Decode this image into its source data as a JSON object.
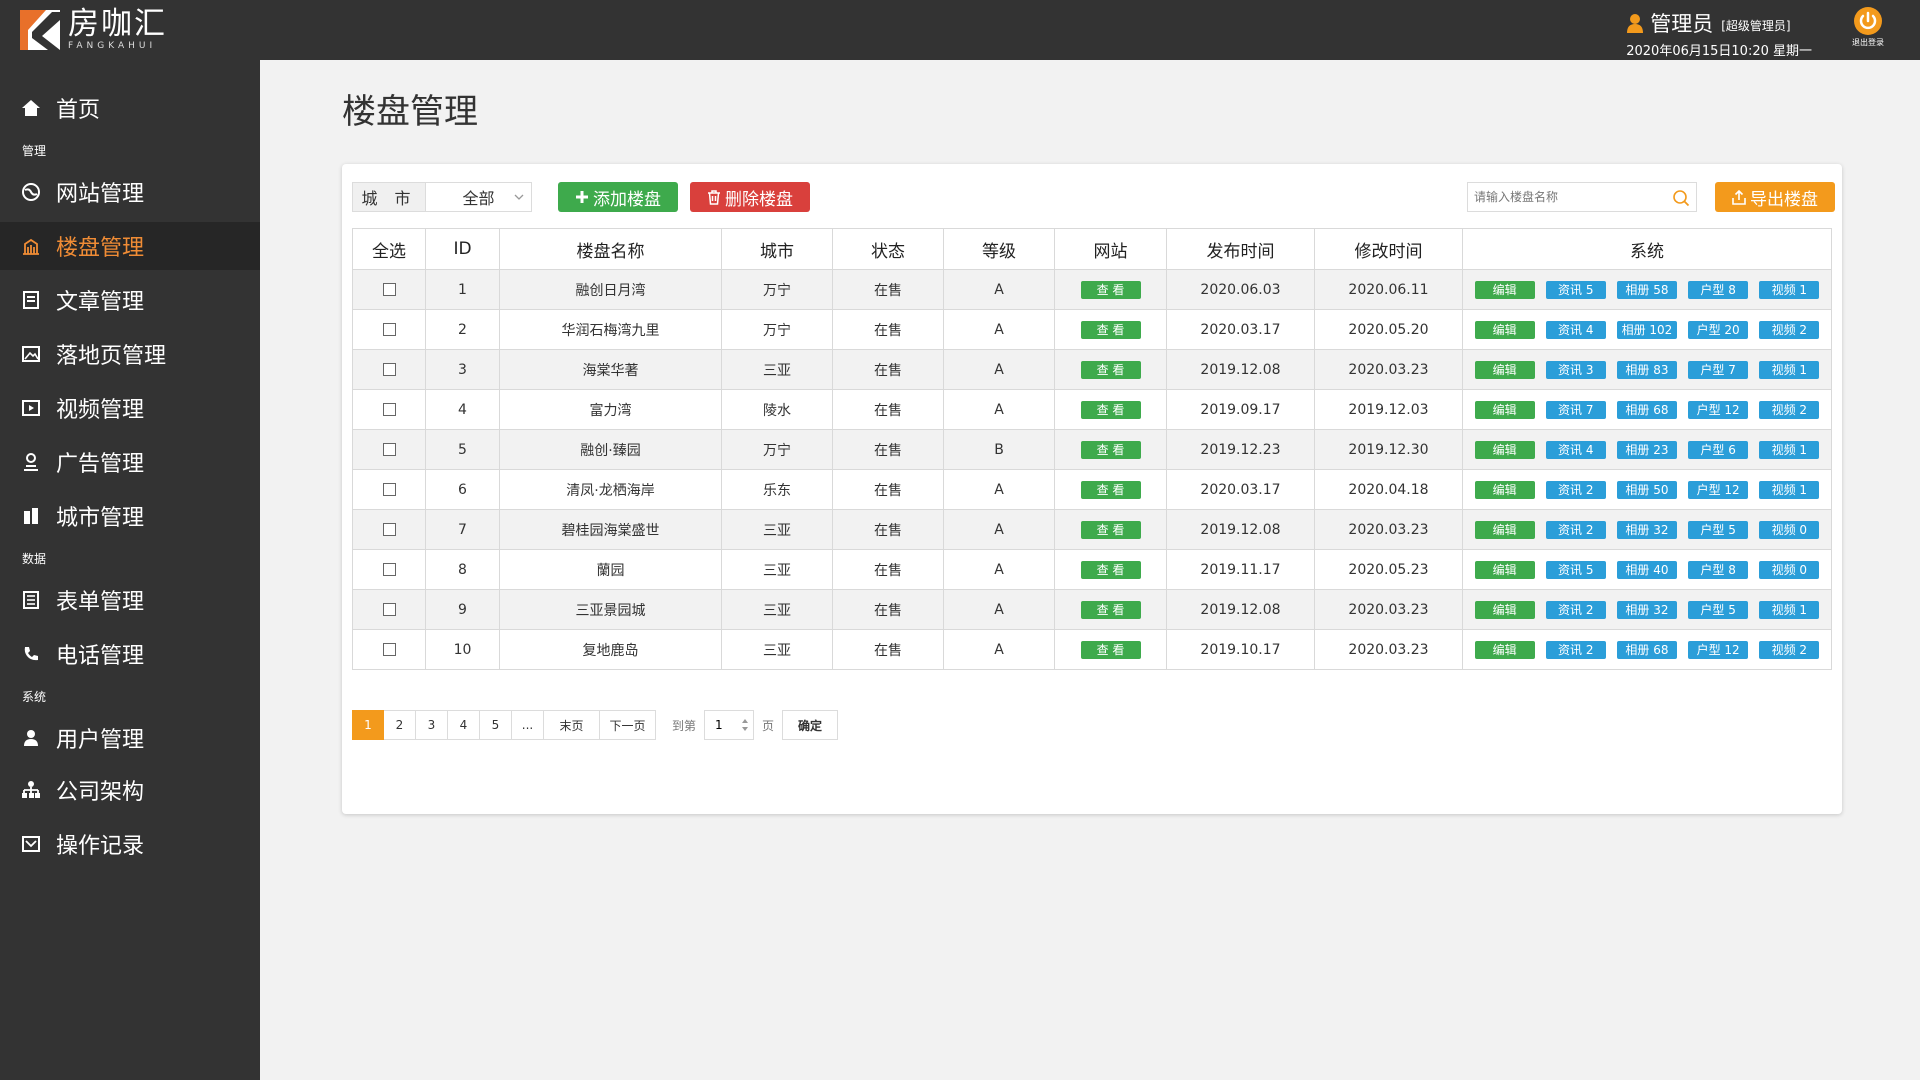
{
  "brand": {
    "name_cn": "房咖汇",
    "name_en": "FANGKAHUI"
  },
  "header": {
    "user_name": "管理员",
    "user_role": "[超级管理员]",
    "datetime": "2020年06月15日10:20 星期一",
    "logout_label": "退出登录"
  },
  "sidebar": {
    "home": "首页",
    "section_manage": "管理",
    "section_data": "数据",
    "section_system": "系统",
    "items": [
      {
        "label": "网站管理",
        "icon": "globe-icon"
      },
      {
        "label": "楼盘管理",
        "icon": "building-icon",
        "active": true
      },
      {
        "label": "文章管理",
        "icon": "article-icon"
      },
      {
        "label": "落地页管理",
        "icon": "image-icon"
      },
      {
        "label": "视频管理",
        "icon": "video-icon"
      },
      {
        "label": "广告管理",
        "icon": "ad-icon"
      },
      {
        "label": "城市管理",
        "icon": "city-icon"
      },
      {
        "label": "表单管理",
        "icon": "form-icon"
      },
      {
        "label": "电话管理",
        "icon": "phone-icon"
      },
      {
        "label": "用户管理",
        "icon": "user-icon"
      },
      {
        "label": "公司架构",
        "icon": "org-chart-icon"
      },
      {
        "label": "操作记录",
        "icon": "log-icon"
      }
    ]
  },
  "page": {
    "title": "楼盘管理"
  },
  "toolbar": {
    "city_label": "城 市",
    "city_value": "全部",
    "add_label": "添加楼盘",
    "delete_label": "删除楼盘",
    "search_placeholder": "请输入楼盘名称",
    "export_label": "导出楼盘"
  },
  "table": {
    "headers": [
      "全选",
      "ID",
      "楼盘名称",
      "城市",
      "状态",
      "等级",
      "网站",
      "发布时间",
      "修改时间",
      "系统"
    ],
    "view_label": "查 看",
    "edit_label": "编辑",
    "rows": [
      {
        "id": "1",
        "name": "融创日月湾",
        "city": "万宁",
        "status": "在售",
        "level": "A",
        "published": "2020.06.03",
        "modified": "2020.06.11",
        "news": "资讯 5",
        "album": "相册 58",
        "layout": "户型 8",
        "video": "视频 1"
      },
      {
        "id": "2",
        "name": "华润石梅湾九里",
        "city": "万宁",
        "status": "在售",
        "level": "A",
        "published": "2020.03.17",
        "modified": "2020.05.20",
        "news": "资讯 4",
        "album": "相册 102",
        "layout": "户型 20",
        "video": "视频 2"
      },
      {
        "id": "3",
        "name": "海棠华著",
        "city": "三亚",
        "status": "在售",
        "level": "A",
        "published": "2019.12.08",
        "modified": "2020.03.23",
        "news": "资讯 3",
        "album": "相册 83",
        "layout": "户型 7",
        "video": "视频 1"
      },
      {
        "id": "4",
        "name": "富力湾",
        "city": "陵水",
        "status": "在售",
        "level": "A",
        "published": "2019.09.17",
        "modified": "2019.12.03",
        "news": "资讯 7",
        "album": "相册 68",
        "layout": "户型 12",
        "video": "视频 2"
      },
      {
        "id": "5",
        "name": "融创·臻园",
        "city": "万宁",
        "status": "在售",
        "level": "B",
        "published": "2019.12.23",
        "modified": "2019.12.30",
        "news": "资讯 4",
        "album": "相册 23",
        "layout": "户型 6",
        "video": "视频 1"
      },
      {
        "id": "6",
        "name": "清凤·龙栖海岸",
        "city": "乐东",
        "status": "在售",
        "level": "A",
        "published": "2020.03.17",
        "modified": "2020.04.18",
        "news": "资讯 2",
        "album": "相册 50",
        "layout": "户型 12",
        "video": "视频 1"
      },
      {
        "id": "7",
        "name": "碧桂园海棠盛世",
        "city": "三亚",
        "status": "在售",
        "level": "A",
        "published": "2019.12.08",
        "modified": "2020.03.23",
        "news": "资讯 2",
        "album": "相册 32",
        "layout": "户型 5",
        "video": "视频 0"
      },
      {
        "id": "8",
        "name": "蘭园",
        "city": "三亚",
        "status": "在售",
        "level": "A",
        "published": "2019.11.17",
        "modified": "2020.05.23",
        "news": "资讯 5",
        "album": "相册 40",
        "layout": "户型 8",
        "video": "视频 0"
      },
      {
        "id": "9",
        "name": "三亚景园城",
        "city": "三亚",
        "status": "在售",
        "level": "A",
        "published": "2019.12.08",
        "modified": "2020.03.23",
        "news": "资讯 2",
        "album": "相册 32",
        "layout": "户型 5",
        "video": "视频 1"
      },
      {
        "id": "10",
        "name": "复地鹿岛",
        "city": "三亚",
        "status": "在售",
        "level": "A",
        "published": "2019.10.17",
        "modified": "2020.03.23",
        "news": "资讯 2",
        "album": "相册 68",
        "layout": "户型 12",
        "video": "视频 2"
      }
    ]
  },
  "pagination": {
    "pages": [
      "1",
      "2",
      "3",
      "4",
      "5",
      "..."
    ],
    "current": "1",
    "last_label": "末页",
    "next_label": "下一页",
    "goto_label": "到第",
    "goto_value": "1",
    "page_unit": "页",
    "confirm_label": "确定"
  },
  "colors": {
    "sidebar_bg": "#333333",
    "accent_orange": "#f39a1c",
    "active_text": "#f08c35",
    "green": "#3eaa4c",
    "red": "#d9403c",
    "blue": "#2b9ed9"
  }
}
